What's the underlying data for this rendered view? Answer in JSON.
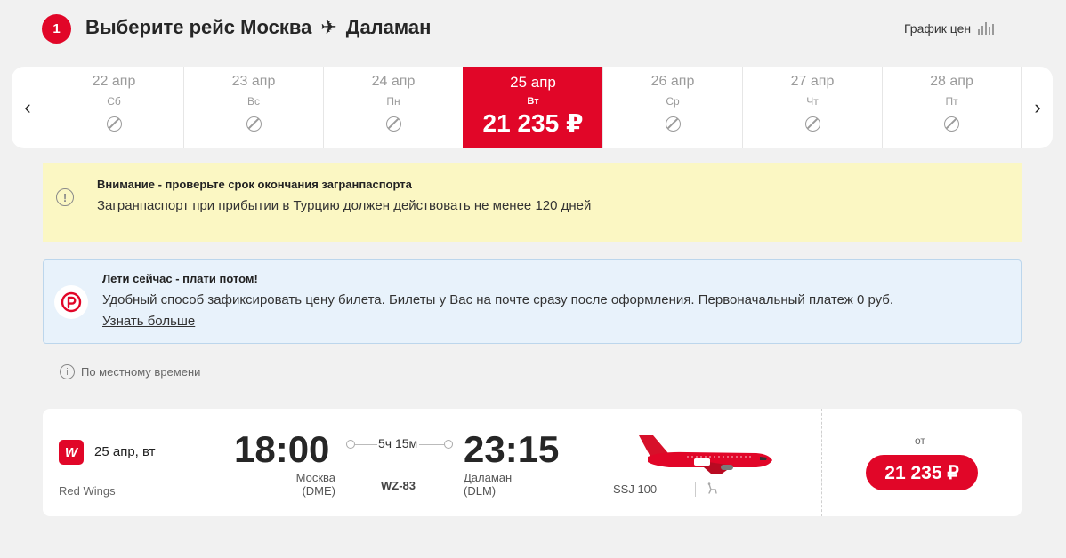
{
  "header": {
    "step_number": "1",
    "title_prefix": "Выберите рейс Москва",
    "title_suffix": "Даламан",
    "price_graph_label": "График цен"
  },
  "date_strip": {
    "days": [
      {
        "date": "22 апр",
        "weekday": "Сб",
        "available": false
      },
      {
        "date": "23 апр",
        "weekday": "Вс",
        "available": false
      },
      {
        "date": "24 апр",
        "weekday": "Пн",
        "available": false
      },
      {
        "date": "25 апр",
        "weekday": "Вт",
        "available": true,
        "price": "21 235 ₽"
      },
      {
        "date": "26 апр",
        "weekday": "Ср",
        "available": false
      },
      {
        "date": "27 апр",
        "weekday": "Чт",
        "available": false
      },
      {
        "date": "28 апр",
        "weekday": "Пт",
        "available": false
      }
    ]
  },
  "warning": {
    "title": "Внимание - проверьте срок окончания загранпаспорта",
    "text": "Загранпаспорт при прибытии в Турцию должен действовать не менее 120 дней"
  },
  "promo": {
    "title": "Лети сейчас - плати потом!",
    "text": "Удобный способ зафиксировать цену билета. Билеты у Вас на почте сразу после оформления. Первоначальный платеж 0 руб.",
    "link": "Узнать больше"
  },
  "local_time_note": "По местному времени",
  "flight": {
    "date": "25 апр, вт",
    "airline": "Red Wings",
    "departure_time": "18:00",
    "departure_city": "Москва",
    "departure_code": "(DME)",
    "duration": "5ч 15м",
    "flight_number": "WZ-83",
    "arrival_time": "23:15",
    "arrival_city": "Даламан",
    "arrival_code": "(DLM)",
    "aircraft": "SSJ 100",
    "from_label": "от",
    "price": "21 235 ₽"
  },
  "colors": {
    "brand_red": "#e10628",
    "warning_bg": "#fbf7c3",
    "info_bg": "#e8f2fb"
  }
}
